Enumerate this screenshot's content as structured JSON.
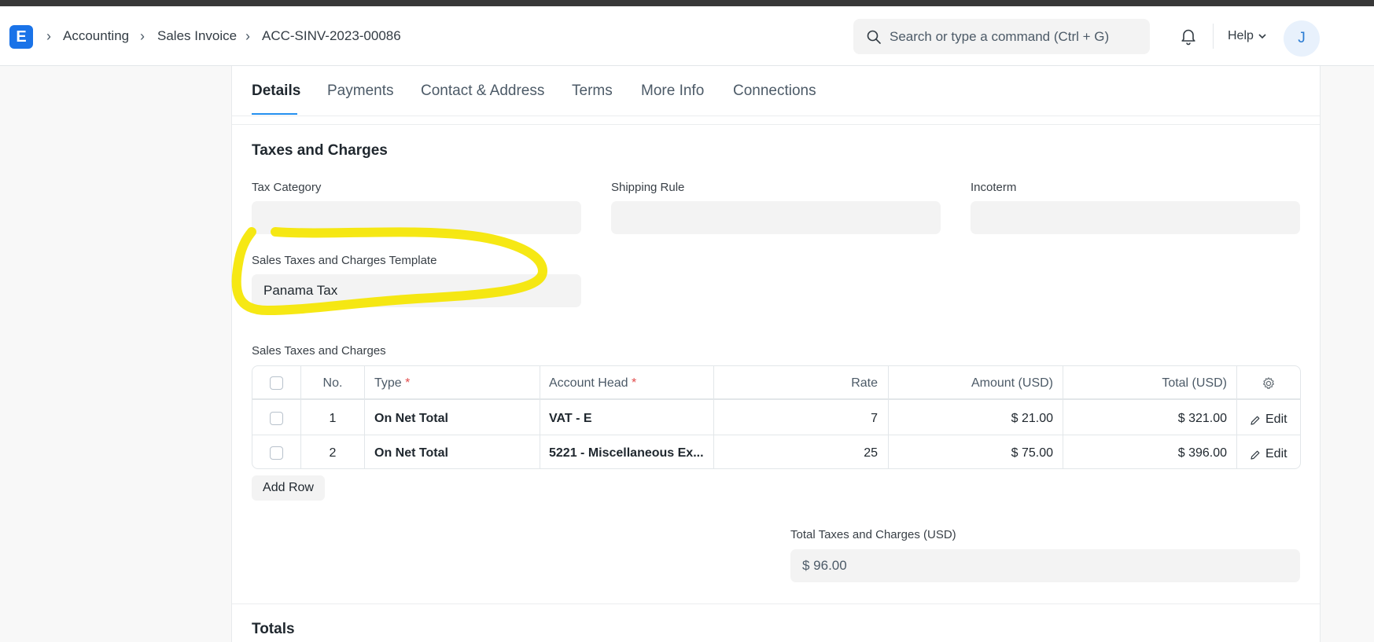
{
  "navbar": {
    "logo_letter": "E",
    "breadcrumbs": [
      "Accounting",
      "Sales Invoice",
      "ACC-SINV-2023-00086"
    ],
    "search_placeholder": "Search or type a command (Ctrl + G)",
    "help_label": "Help",
    "avatar_initial": "J"
  },
  "tabs": [
    "Details",
    "Payments",
    "Contact & Address",
    "Terms",
    "More Info",
    "Connections"
  ],
  "taxes_section": {
    "title": "Taxes and Charges",
    "tax_category": {
      "label": "Tax Category",
      "value": ""
    },
    "shipping_rule": {
      "label": "Shipping Rule",
      "value": ""
    },
    "incoterm": {
      "label": "Incoterm",
      "value": ""
    },
    "template": {
      "label": "Sales Taxes and Charges Template",
      "value": "Panama Tax"
    },
    "table_label": "Sales Taxes and Charges",
    "columns": {
      "no": "No.",
      "type": "Type",
      "account_head": "Account Head",
      "rate": "Rate",
      "amount": "Amount (USD)",
      "total": "Total (USD)",
      "required_mark": "*"
    },
    "rows": [
      {
        "no": "1",
        "type": "On Net Total",
        "account_head": "VAT - E",
        "rate": "7",
        "amount": "$ 21.00",
        "total": "$ 321.00",
        "edit": "Edit"
      },
      {
        "no": "2",
        "type": "On Net Total",
        "account_head": "5221 - Miscellaneous Ex...",
        "rate": "25",
        "amount": "$ 75.00",
        "total": "$ 396.00",
        "edit": "Edit"
      }
    ],
    "add_row": "Add Row",
    "total_taxes": {
      "label": "Total Taxes and Charges (USD)",
      "value": "$ 96.00"
    }
  },
  "totals_section": {
    "title": "Totals"
  },
  "colors": {
    "accent": "#2490ef",
    "logo": "#1a73e8",
    "highlight": "#f5e600",
    "required": "#e24c4c"
  }
}
